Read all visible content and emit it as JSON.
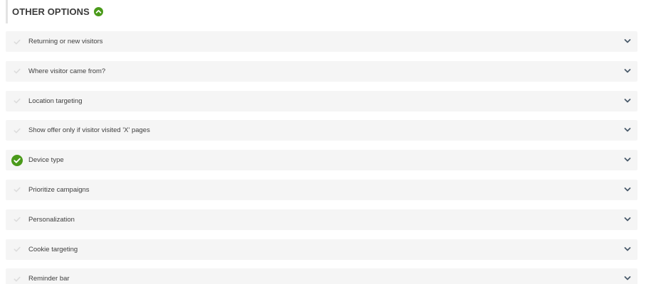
{
  "header": {
    "title": "OTHER OPTIONS",
    "toggle_icon": "chevron-up-circle-icon"
  },
  "colors": {
    "accent": "#4a9a1a",
    "row_bg": "#f5f5f5",
    "check_inactive": "#dcdcdc",
    "chevron": "#4a5a6a"
  },
  "options": [
    {
      "label": "Returning or new visitors",
      "enabled": false
    },
    {
      "label": "Where visitor came from?",
      "enabled": false
    },
    {
      "label": "Location targeting",
      "enabled": false
    },
    {
      "label": "Show offer only if visitor visited 'X' pages",
      "enabled": false
    },
    {
      "label": "Device type",
      "enabled": true
    },
    {
      "label": "Prioritize campaigns",
      "enabled": false
    },
    {
      "label": "Personalization",
      "enabled": false
    },
    {
      "label": "Cookie targeting",
      "enabled": false
    },
    {
      "label": "Reminder bar",
      "enabled": false
    }
  ]
}
